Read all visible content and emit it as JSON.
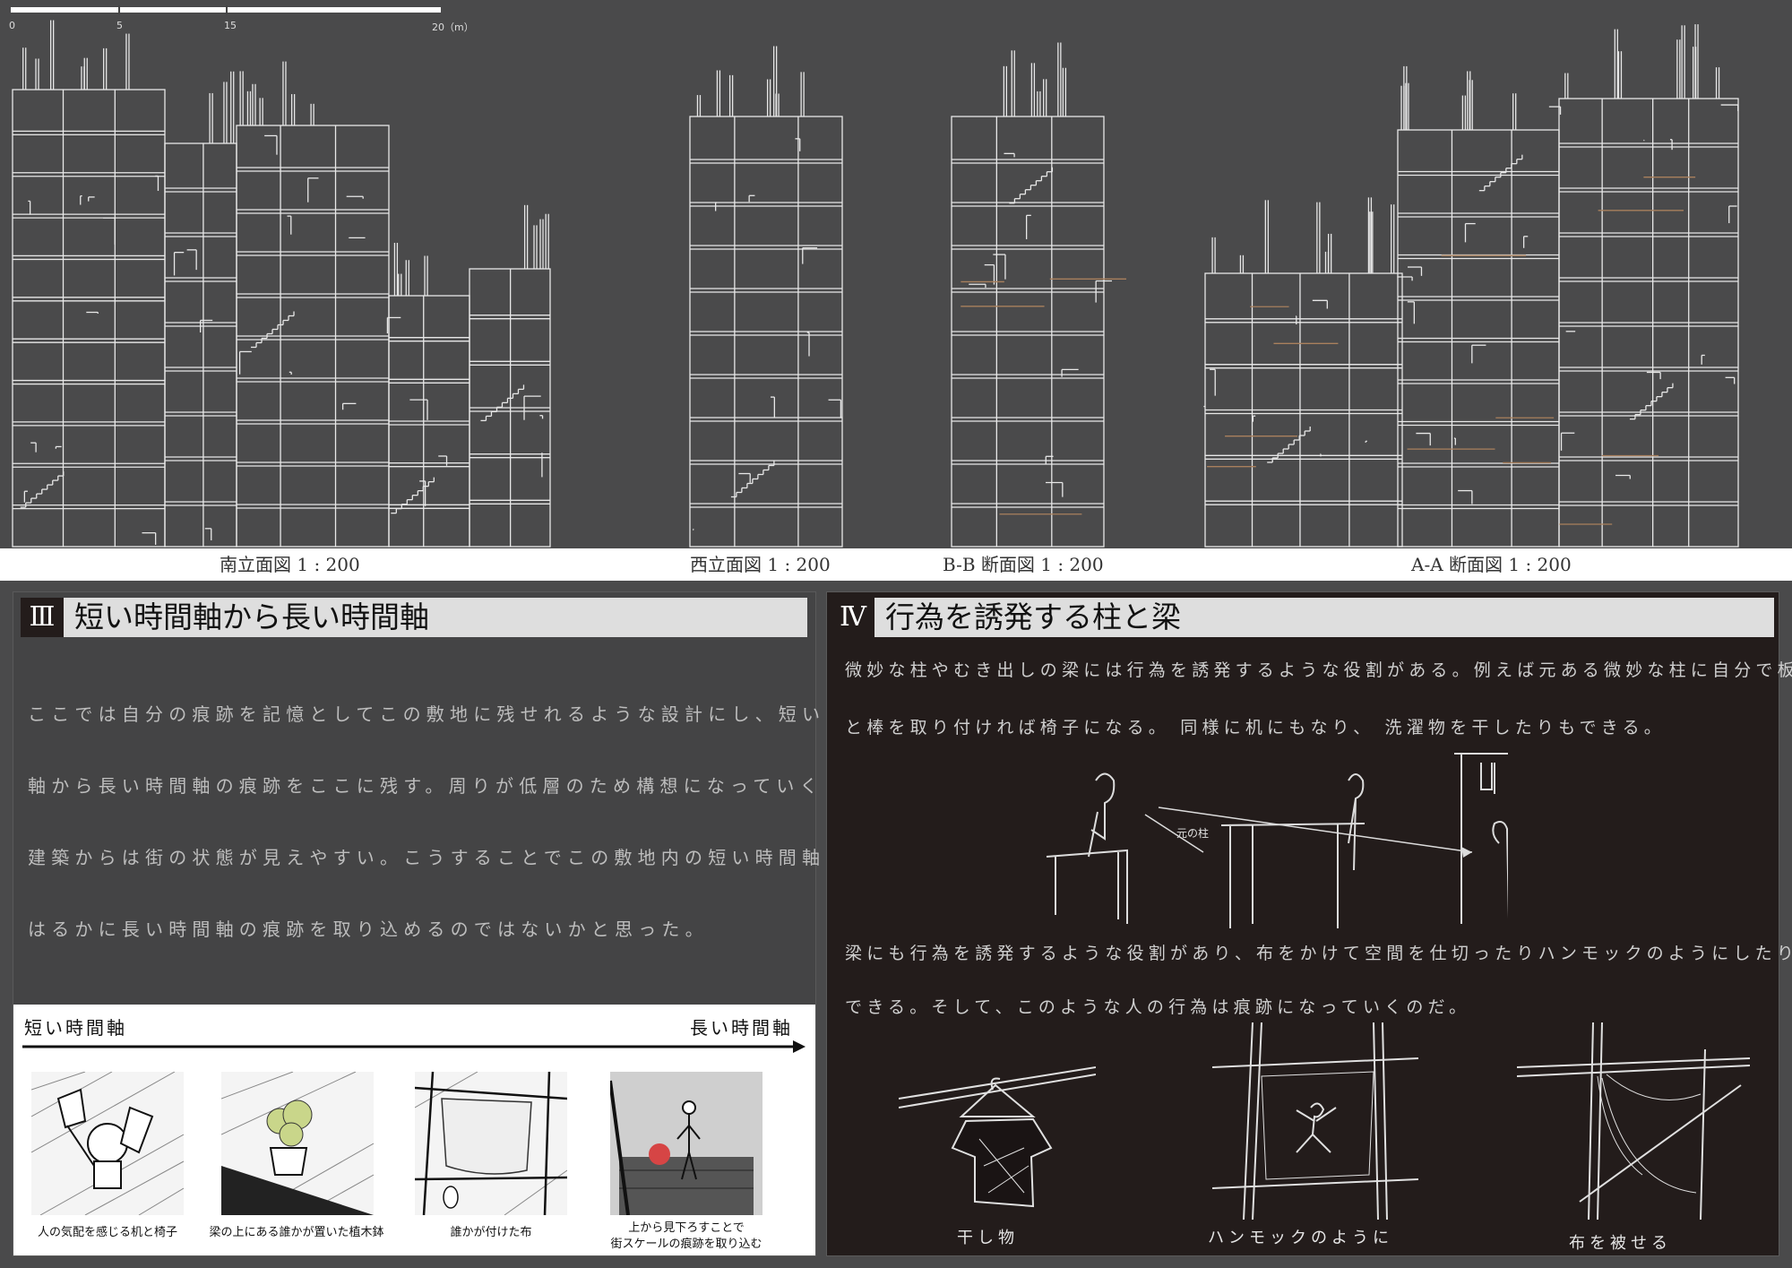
{
  "scale_bar": {
    "ticks": [
      "0",
      "5",
      "15",
      "20（m）"
    ]
  },
  "drawings": {
    "south_elevation": "南立面図 1 : 200",
    "west_elevation": "西立面図 1 : 200",
    "section_bb": "B-B 断面図 1 : 200",
    "section_aa": "A-A 断面図 1 : 200"
  },
  "section3": {
    "number": "Ⅲ",
    "title": "短い時間軸から長い時間軸",
    "paragraph": [
      "ここでは自分の痕跡を記憶としてこの敷地に残せれるような設計にし、短い時間",
      "軸から長い時間軸の痕跡をここに残す。周りが低層のため構想になっていくこの",
      "建築からは街の状態が見えやすい。こうすることでこの敷地内の短い時間軸より",
      "はるかに長い時間軸の痕跡を取り込めるのではないかと思った。"
    ],
    "timeline": {
      "start_label": "短い時間軸",
      "end_label": "長い時間軸",
      "images": [
        {
          "caption": "人の気配を感じる机と椅子"
        },
        {
          "caption": "梁の上にある誰かが置いた植木鉢"
        },
        {
          "caption": "誰かが付けた布"
        },
        {
          "caption_line1": "上から見下ろすことで",
          "caption_line2": "街スケールの痕跡を取り込む"
        }
      ]
    }
  },
  "section4": {
    "number": "Ⅳ",
    "title": "行為を誘発する柱と梁",
    "paragraph1": [
      "微妙な柱やむき出しの梁には行為を誘発するような役割がある。例えば元ある微妙な柱に自分で板",
      "と棒を取り付ければ椅子になる。 同様に机にもなり、 洗濯物を干したりもできる。"
    ],
    "sketch_label": "元の柱",
    "paragraph2": [
      "梁にも行為を誘発するような役割があり、布をかけて空間を仕切ったりハンモックのようにしたりと色々",
      "できる。そして、このような人の行為は痕跡になっていくのだ。"
    ],
    "captions": [
      "干し物",
      "ハンモックのように",
      "布を被せる"
    ]
  }
}
